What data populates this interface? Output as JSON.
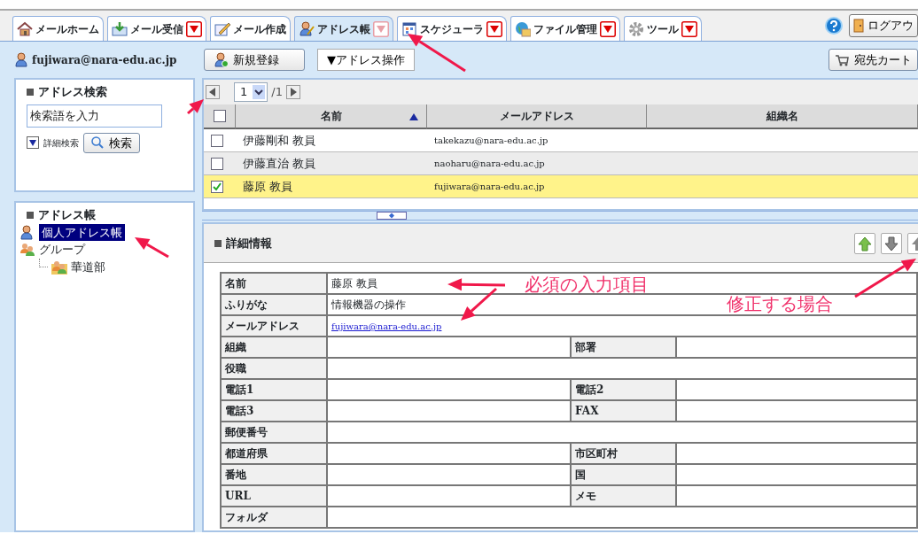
{
  "tabs": [
    {
      "label": "メールホーム",
      "selected": false,
      "dropdown": false
    },
    {
      "label": "メール受信",
      "selected": false,
      "dropdown": true
    },
    {
      "label": "メール作成",
      "selected": false,
      "dropdown": false
    },
    {
      "label": "アドレス帳",
      "selected": true,
      "dropdown": true
    },
    {
      "label": "スケジューラ",
      "selected": false,
      "dropdown": true
    },
    {
      "label": "ファイル管理",
      "selected": false,
      "dropdown": true
    },
    {
      "label": "ツール",
      "selected": false,
      "dropdown": true
    }
  ],
  "logout_button": {
    "label": "ログアウ"
  },
  "user": {
    "email": "fujiwara@nara-edu.ac.jp"
  },
  "toolbar": {
    "new_button": "新規登録",
    "address_menu": "▼アドレス操作",
    "cart_button": "宛先カート"
  },
  "search": {
    "title": "アドレス検索",
    "placeholder": "検索語を入力",
    "advanced_label": "詳細検索",
    "button": "検索"
  },
  "address_book": {
    "title": "アドレス帳",
    "tree": [
      {
        "label": "個人アドレス帳",
        "selected": true
      },
      {
        "label": "グループ",
        "selected": false,
        "children": [
          {
            "label": "華道部",
            "selected": false
          }
        ]
      }
    ]
  },
  "pager": {
    "page": "1",
    "total": "/1"
  },
  "list": {
    "all_checked": false,
    "columns": [
      {
        "label": "名前",
        "sorted": true
      },
      {
        "label": "メールアドレス",
        "sorted": false
      },
      {
        "label": "組織名",
        "sorted": false
      }
    ],
    "rows": [
      {
        "name": "伊藤剛和 教員",
        "email": "takekazu@nara-edu.ac.jp",
        "checked": false,
        "selected": false
      },
      {
        "name": "伊藤直治 教員",
        "email": "naoharu@nara-edu.ac.jp",
        "checked": false,
        "selected": false
      },
      {
        "name": "藤原 教員",
        "email": "fujiwara@nara-edu.ac.jp",
        "checked": true,
        "selected": true
      }
    ]
  },
  "detail": {
    "title": "詳細情報",
    "rows": [
      {
        "kind": "text",
        "label": "名前",
        "value": "藤原 教員"
      },
      {
        "kind": "text",
        "label": "ふりがな",
        "value": "情報機器の操作"
      },
      {
        "kind": "link",
        "label": "メールアドレス",
        "value": "fujiwara@nara-edu.ac.jp"
      },
      {
        "kind": "pair",
        "label": "組織",
        "label_2": "部署"
      },
      {
        "kind": "text",
        "label": "役職"
      },
      {
        "kind": "pair",
        "label": "電話1",
        "label_2": "電話2"
      },
      {
        "kind": "pair",
        "label": "電話3",
        "label_2": "FAX"
      },
      {
        "kind": "text",
        "label": "郵便番号"
      },
      {
        "kind": "pair",
        "label": "都道府県",
        "label_2": "市区町村"
      },
      {
        "kind": "pair",
        "label": "番地",
        "label_2": "国"
      },
      {
        "kind": "pair",
        "label": "URL",
        "label_2": "メモ"
      },
      {
        "kind": "text",
        "label": "フォルダ"
      }
    ]
  },
  "annotations": [
    {
      "text": "必須の入力項目"
    },
    {
      "text": "修正する場合"
    }
  ]
}
